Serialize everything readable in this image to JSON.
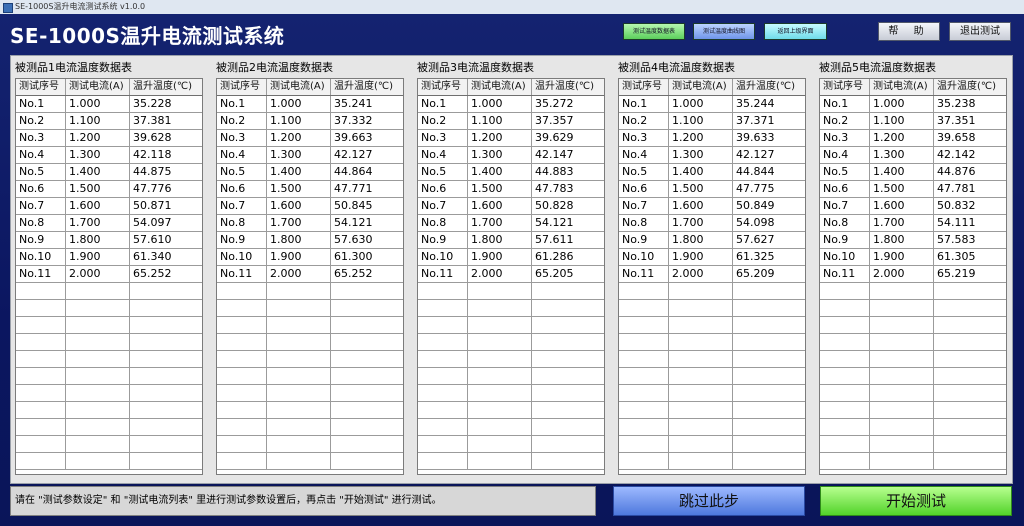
{
  "window_title": "SE-1000S温升电流测试系统 v1.0.0",
  "app_title": "SE-1000S温升电流测试系统",
  "header": {
    "small_buttons": [
      "测试温度数据表",
      "测试温度曲线图",
      "返回上级界面"
    ],
    "help_label": "帮 助",
    "exit_label": "退出测试"
  },
  "table_columns": [
    "测试序号",
    "测试电流(A)",
    "温升温度(℃)"
  ],
  "tables": [
    {
      "title": "被测品1电流温度数据表",
      "rows": [
        [
          "No.1",
          "1.000",
          "35.228"
        ],
        [
          "No.2",
          "1.100",
          "37.381"
        ],
        [
          "No.3",
          "1.200",
          "39.628"
        ],
        [
          "No.4",
          "1.300",
          "42.118"
        ],
        [
          "No.5",
          "1.400",
          "44.875"
        ],
        [
          "No.6",
          "1.500",
          "47.776"
        ],
        [
          "No.7",
          "1.600",
          "50.871"
        ],
        [
          "No.8",
          "1.700",
          "54.097"
        ],
        [
          "No.9",
          "1.800",
          "57.610"
        ],
        [
          "No.10",
          "1.900",
          "61.340"
        ],
        [
          "No.11",
          "2.000",
          "65.252"
        ]
      ]
    },
    {
      "title": "被测品2电流温度数据表",
      "rows": [
        [
          "No.1",
          "1.000",
          "35.241"
        ],
        [
          "No.2",
          "1.100",
          "37.332"
        ],
        [
          "No.3",
          "1.200",
          "39.663"
        ],
        [
          "No.4",
          "1.300",
          "42.127"
        ],
        [
          "No.5",
          "1.400",
          "44.864"
        ],
        [
          "No.6",
          "1.500",
          "47.771"
        ],
        [
          "No.7",
          "1.600",
          "50.845"
        ],
        [
          "No.8",
          "1.700",
          "54.121"
        ],
        [
          "No.9",
          "1.800",
          "57.630"
        ],
        [
          "No.10",
          "1.900",
          "61.300"
        ],
        [
          "No.11",
          "2.000",
          "65.252"
        ]
      ]
    },
    {
      "title": "被测品3电流温度数据表",
      "rows": [
        [
          "No.1",
          "1.000",
          "35.272"
        ],
        [
          "No.2",
          "1.100",
          "37.357"
        ],
        [
          "No.3",
          "1.200",
          "39.629"
        ],
        [
          "No.4",
          "1.300",
          "42.147"
        ],
        [
          "No.5",
          "1.400",
          "44.883"
        ],
        [
          "No.6",
          "1.500",
          "47.783"
        ],
        [
          "No.7",
          "1.600",
          "50.828"
        ],
        [
          "No.8",
          "1.700",
          "54.121"
        ],
        [
          "No.9",
          "1.800",
          "57.611"
        ],
        [
          "No.10",
          "1.900",
          "61.286"
        ],
        [
          "No.11",
          "2.000",
          "65.205"
        ]
      ]
    },
    {
      "title": "被测品4电流温度数据表",
      "rows": [
        [
          "No.1",
          "1.000",
          "35.244"
        ],
        [
          "No.2",
          "1.100",
          "37.371"
        ],
        [
          "No.3",
          "1.200",
          "39.633"
        ],
        [
          "No.4",
          "1.300",
          "42.127"
        ],
        [
          "No.5",
          "1.400",
          "44.844"
        ],
        [
          "No.6",
          "1.500",
          "47.775"
        ],
        [
          "No.7",
          "1.600",
          "50.849"
        ],
        [
          "No.8",
          "1.700",
          "54.098"
        ],
        [
          "No.9",
          "1.800",
          "57.627"
        ],
        [
          "No.10",
          "1.900",
          "61.325"
        ],
        [
          "No.11",
          "2.000",
          "65.209"
        ]
      ]
    },
    {
      "title": "被测品5电流温度数据表",
      "rows": [
        [
          "No.1",
          "1.000",
          "35.238"
        ],
        [
          "No.2",
          "1.100",
          "37.351"
        ],
        [
          "No.3",
          "1.200",
          "39.658"
        ],
        [
          "No.4",
          "1.300",
          "42.142"
        ],
        [
          "No.5",
          "1.400",
          "44.876"
        ],
        [
          "No.6",
          "1.500",
          "47.781"
        ],
        [
          "No.7",
          "1.600",
          "50.832"
        ],
        [
          "No.8",
          "1.700",
          "54.111"
        ],
        [
          "No.9",
          "1.800",
          "57.583"
        ],
        [
          "No.10",
          "1.900",
          "61.305"
        ],
        [
          "No.11",
          "2.000",
          "65.219"
        ]
      ]
    }
  ],
  "status_text": "请在 \"测试参数设定\" 和 \"测试电流列表\" 里进行测试参数设置后，再点击 \"开始测试\" 进行测试。",
  "skip_label": "跳过此步",
  "start_label": "开始测试"
}
